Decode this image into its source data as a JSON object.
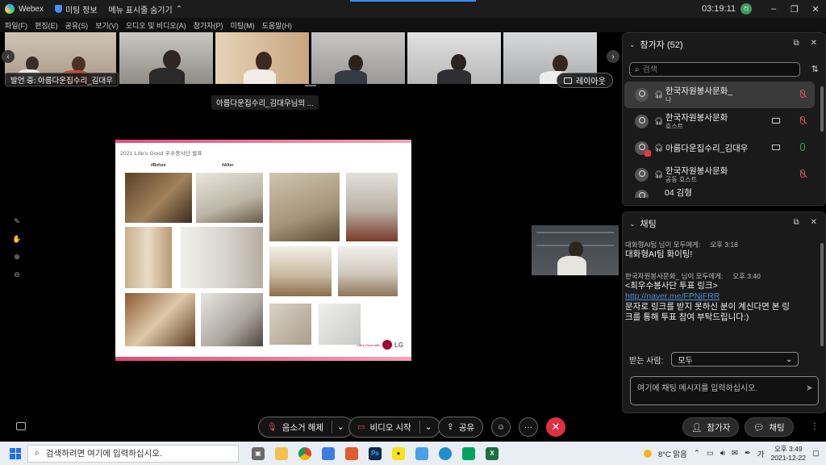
{
  "window": {
    "app_name": "Webex",
    "meeting_info": "미팅 정보",
    "hide_menu": "메뉴 표시줄 숨기기",
    "clock": "03:19:11",
    "user_initial": "리",
    "minimize": "–",
    "restore": "❐",
    "close": "✕"
  },
  "menu": {
    "items": [
      "파일(F)",
      "편집(E)",
      "공유(S)",
      "보기(V)",
      "오디오 및 비디오(A)",
      "참가자(P)",
      "미팅(M)",
      "도움말(H)"
    ]
  },
  "strip": {
    "speaking_label": "발언 중: 아름다운집수리_김대우",
    "layout_button": "레이아웃",
    "prev_arrow": "‹",
    "next_arrow": "›",
    "share_caption": "아름다운집수리_김대우님의 ..."
  },
  "slide": {
    "title": "2021 Life's Good 우수봉사단 발표",
    "before_label": "#Before",
    "after_label": "#After",
    "lg_tagline": "Life's Good with",
    "lg_word": "LG"
  },
  "participants": {
    "title": "참가자 (52)",
    "search_placeholder": "검색",
    "rows": [
      {
        "name": "한국자원봉사문화_",
        "role": "나",
        "mic": "muted",
        "camera": false
      },
      {
        "name": "한국자원봉사문화",
        "role": "호스트",
        "mic": "muted",
        "camera": true
      },
      {
        "name": "아름다운집수리_김대우",
        "role": "",
        "mic": "on",
        "camera": true
      },
      {
        "name": "한국자원봉사문화",
        "role": "공동 호스트",
        "mic": "muted",
        "camera": false
      }
    ],
    "partial_row": "04 김형"
  },
  "chat": {
    "title": "채팅",
    "messages": [
      {
        "from": "대화형AI팀  님이 모두에게:",
        "time": "오후 3:18",
        "lines": [
          "대화형AI팀 화이팅!"
        ]
      },
      {
        "from": "한국자원봉사문화_ 님이 모두에게:",
        "time": "오후 3:40",
        "lines": [
          "<최우수봉사단 투표 링크>"
        ],
        "link": "http://naver.me/FPNiFRR",
        "after": [
          "문자로 링크를 받지 못하신 분이 계신다면 본 링",
          "크를 통해 투표 참여 부탁드립니다:)"
        ]
      }
    ],
    "recipient_label": "받는 사람:",
    "recipient_value": "모두",
    "input_placeholder": "여기에 채팅 메시지를 입력하십시오."
  },
  "controls": {
    "mute": "음소거 해제",
    "video": "비디오 시작",
    "share": "공유",
    "participants": "참가자",
    "chat": "채팅"
  },
  "taskbar": {
    "search": "검색하려면 여기에 입력하십시오.",
    "weather": "8°C  맑음",
    "ime": "가",
    "time": "오후 3:49",
    "date": "2021-12-22"
  },
  "colors": {
    "accent_blue": "#3a8fff",
    "end_call_red": "#e0303f",
    "mic_on_green": "#2bb24c",
    "slide_pink": "#e24a7a",
    "lg_red": "#a50034"
  }
}
